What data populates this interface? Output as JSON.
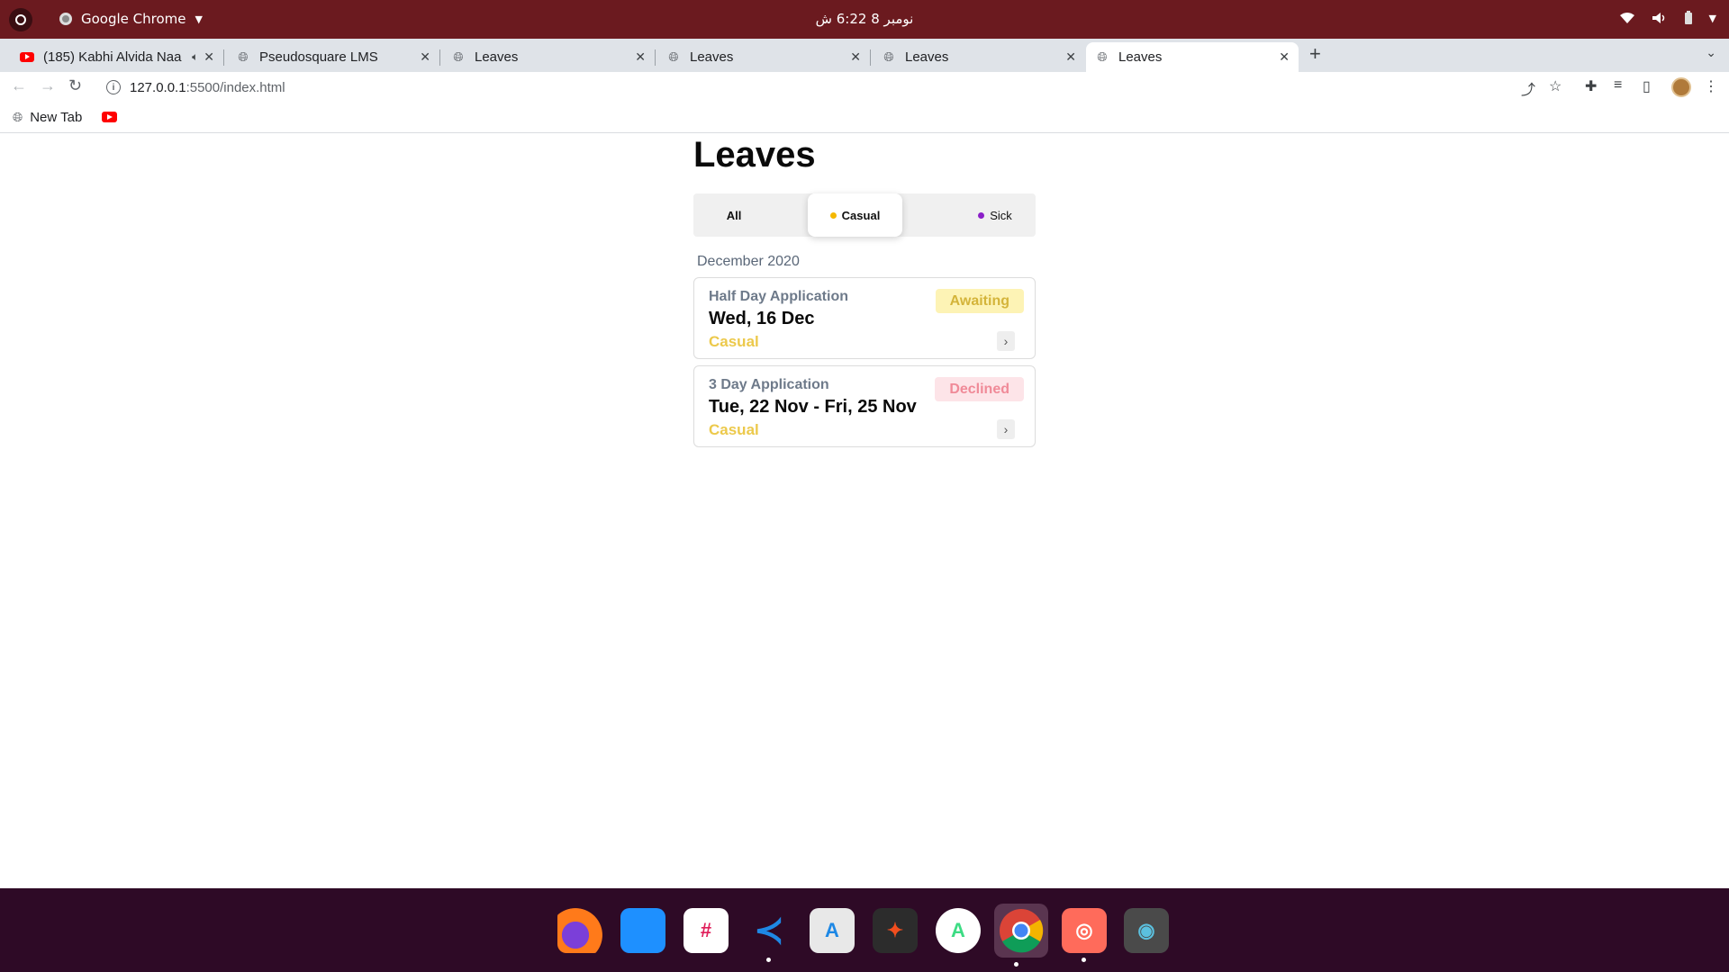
{
  "system_bar": {
    "app_name": "Google Chrome",
    "clock": "نومبر 8  6:22 ش"
  },
  "browser": {
    "tabs": [
      {
        "title": "(185) Kabhi Alvida Naa",
        "favicon": "youtube-icon",
        "audio": true,
        "active": false
      },
      {
        "title": "Pseudosquare LMS",
        "favicon": "globe-icon",
        "active": false
      },
      {
        "title": "Leaves",
        "favicon": "globe-icon",
        "active": false
      },
      {
        "title": "Leaves",
        "favicon": "globe-icon",
        "active": false
      },
      {
        "title": "Leaves",
        "favicon": "globe-icon",
        "active": false
      },
      {
        "title": "Leaves",
        "favicon": "globe-icon",
        "active": true
      }
    ],
    "url_host": "127.0.0.1",
    "url_path": ":5500/index.html",
    "bookmarks": [
      {
        "label": "New Tab",
        "icon": "globe-icon"
      },
      {
        "label": "",
        "icon": "youtube-icon"
      }
    ]
  },
  "page": {
    "title": "Leaves",
    "filters": [
      {
        "label": "All",
        "dot_color": null,
        "active": false
      },
      {
        "label": "Casual",
        "dot_color": "#f5b800",
        "active": true
      },
      {
        "label": "Sick",
        "dot_color": "#8b1fc8",
        "active": false
      }
    ],
    "month": "December 2020",
    "applications": [
      {
        "kind": "Half Day Application",
        "date": "Wed, 16 Dec",
        "type": "Casual",
        "status": "Awaiting",
        "status_color": "#d4b43a",
        "status_bg": "#fdf3b5",
        "type_color": "#ecc94b"
      },
      {
        "kind": "3 Day Application",
        "date": "Tue, 22 Nov - Fri, 25 Nov",
        "type": "Casual",
        "status": "Declined",
        "status_color": "#f08a98",
        "status_bg": "#fde4e8",
        "type_color": "#ecc94b"
      }
    ]
  },
  "dock": {
    "apps": [
      {
        "name": "firefox-icon",
        "running": false
      },
      {
        "name": "files-icon",
        "running": false
      },
      {
        "name": "slack-icon",
        "running": false
      },
      {
        "name": "vscode-icon",
        "running": true
      },
      {
        "name": "software-center-icon",
        "running": false
      },
      {
        "name": "figma-icon",
        "running": false
      },
      {
        "name": "android-studio-icon",
        "running": false
      },
      {
        "name": "chrome-icon",
        "running": true,
        "focused": true
      },
      {
        "name": "screenshot-icon",
        "running": true
      },
      {
        "name": "camera-icon",
        "running": false
      }
    ]
  }
}
